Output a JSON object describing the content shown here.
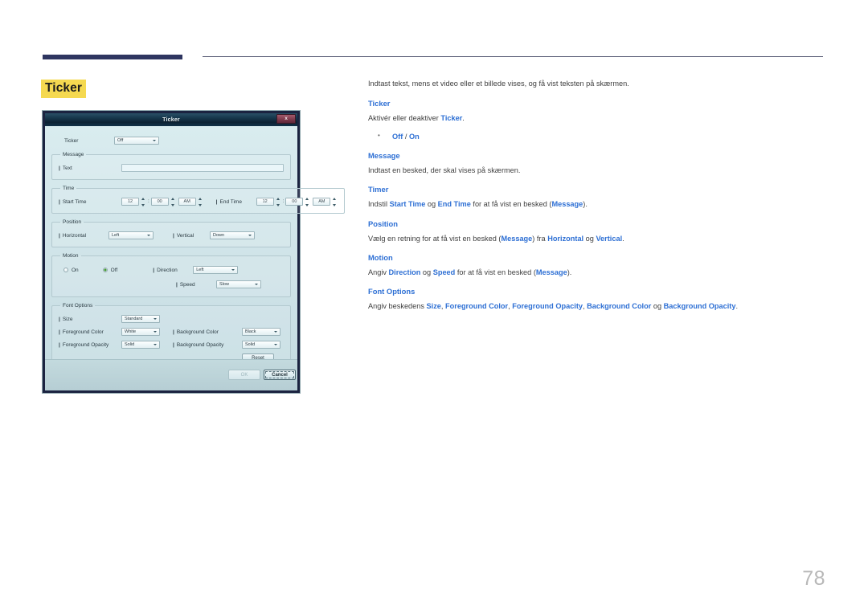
{
  "page": {
    "number": "78",
    "title": "Ticker"
  },
  "dialog": {
    "title": "Ticker",
    "close_label": "x",
    "ticker_row": {
      "label": "Ticker",
      "value": "Off"
    },
    "message_group": {
      "legend": "Message",
      "text_label": "Text",
      "text_value": "",
      "text_placeholder": ""
    },
    "time_group": {
      "legend": "Time",
      "start_label": "Start Time",
      "start_hour": "12",
      "start_minute": "00",
      "start_meridiem": "AM",
      "end_label": "End Time",
      "end_hour": "12",
      "end_minute": "00",
      "end_meridiem": "AM",
      "colon": ":"
    },
    "position_group": {
      "legend": "Position",
      "horizontal_label": "Horizontal",
      "horizontal_value": "Left",
      "vertical_label": "Vertical",
      "vertical_value": "Down"
    },
    "motion_group": {
      "legend": "Motion",
      "on_label": "On",
      "off_label": "Off",
      "selected": "Off",
      "direction_label": "Direction",
      "direction_value": "Left",
      "speed_label": "Speed",
      "speed_value": "Slow"
    },
    "font_options_group": {
      "legend": "Font Options",
      "size_label": "Size",
      "size_value": "Standard",
      "foreground_color_label": "Foreground Color",
      "foreground_color_value": "White",
      "background_color_label": "Background Color",
      "background_color_value": "Black",
      "foreground_opacity_label": "Foreground Opacity",
      "foreground_opacity_value": "Solid",
      "background_opacity_label": "Background Opacity",
      "background_opacity_value": "Solid",
      "reset_label": "Reset"
    },
    "footer": {
      "ok_label": "OK",
      "cancel_label": "Cancel"
    }
  },
  "content": {
    "intro": "Indtast tekst, mens et video eller et billede vises, og få vist teksten på skærmen.",
    "sections": [
      {
        "head": "Ticker",
        "body_pre": "Aktivér eller deaktiver ",
        "body_hl": "Ticker",
        "body_post": ".",
        "options": {
          "first": "Off",
          "sep": " / ",
          "second": "On"
        }
      },
      {
        "head": "Message",
        "body": "Indtast en besked, der skal vises på skærmen."
      },
      {
        "head": "Timer",
        "t1": "Indstil ",
        "h1": "Start Time",
        "t2": " og ",
        "h2": "End Time",
        "t3": " for at få vist en besked (",
        "h3": "Message",
        "t4": ")."
      },
      {
        "head": "Position",
        "t1": "Vælg en retning for at få vist en besked (",
        "h1": "Message",
        "t2": ") fra ",
        "h2": "Horizontal",
        "t3": " og ",
        "h3": "Vertical",
        "t4": "."
      },
      {
        "head": "Motion",
        "t1": "Angiv ",
        "h1": "Direction",
        "t2": " og ",
        "h2": "Speed",
        "t3": " for at få vist en besked (",
        "h3": "Message",
        "t4": ")."
      },
      {
        "head": "Font Options",
        "t1": "Angiv beskedens ",
        "h1": "Size",
        "t2": ", ",
        "h2": "Foreground Color",
        "t3": ", ",
        "h3": "Foreground Opacity",
        "t4": ", ",
        "h4": "Background Color",
        "t5": " og ",
        "h5": "Background Opacity",
        "t6": "."
      }
    ]
  },
  "colors": {
    "highlight_yellow": "#f5d950",
    "link_blue": "#2d6fd4",
    "rule_navy": "#2e3560",
    "dialog_border": "#1b2340",
    "dialog_bg": "#cfe2e6",
    "close_red": "#7e3a4d",
    "radio_green": "#4fb13a",
    "page_number_gray": "#b8b8b8"
  }
}
